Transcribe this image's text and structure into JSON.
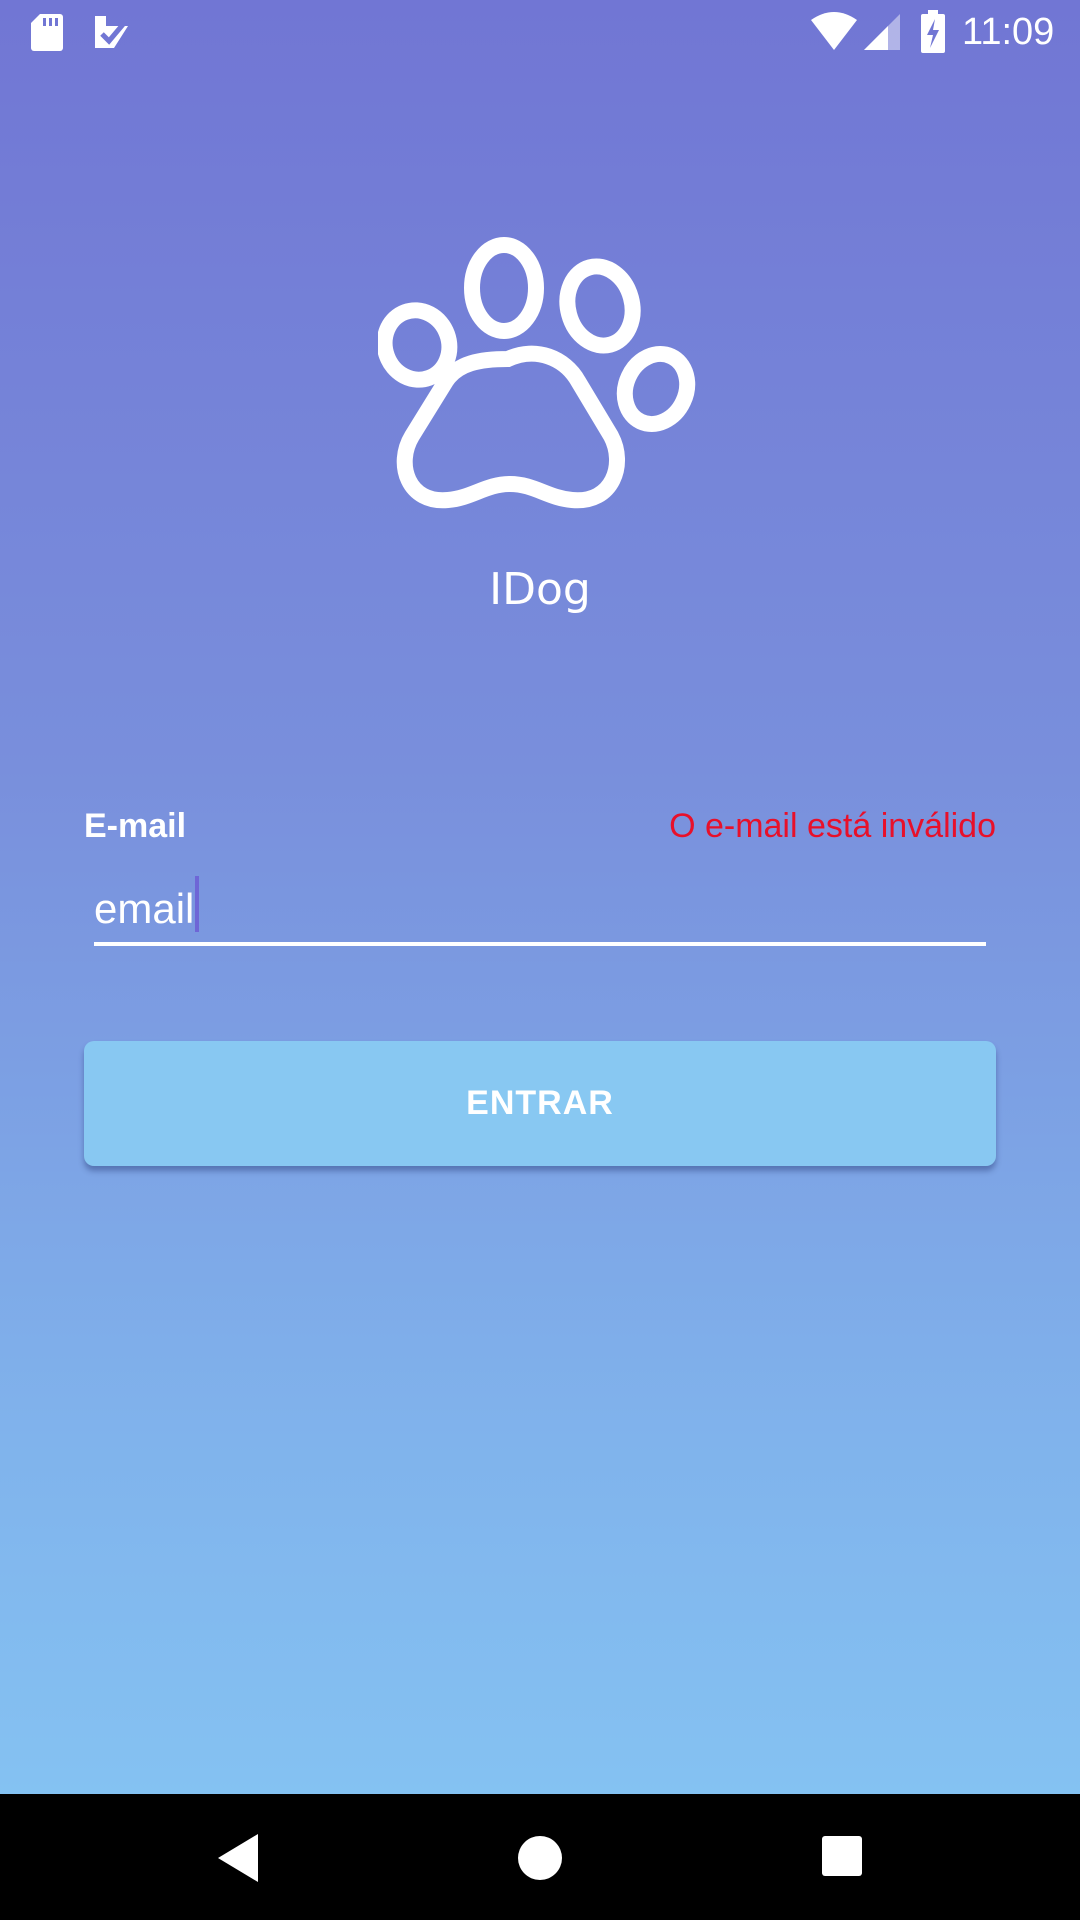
{
  "status_bar": {
    "time": "11:09",
    "icons": [
      "sd-card-icon",
      "task-check-icon",
      "wifi-icon",
      "cell-signal-icon",
      "battery-charging-icon"
    ]
  },
  "app": {
    "logo_icon": "paw-icon",
    "name": "IDog"
  },
  "form": {
    "email_label": "E-mail",
    "email_error": "O e-mail está inválido",
    "email_value": "email",
    "submit_label": "ENTRAR"
  },
  "colors": {
    "gradient_top": "#7176d4",
    "gradient_bottom": "#86c7f4",
    "button": "#88c8f2",
    "error": "#e8102a",
    "text": "#ffffff"
  },
  "nav_bar": {
    "buttons": [
      "back-icon",
      "home-icon",
      "recents-icon"
    ]
  }
}
